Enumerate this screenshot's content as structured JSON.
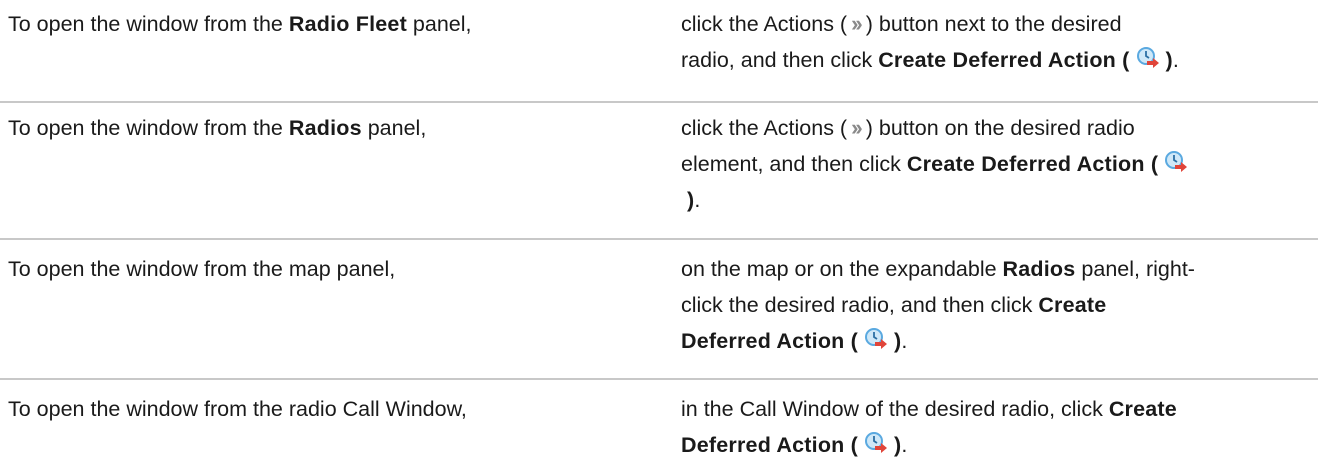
{
  "rows": [
    {
      "left": {
        "prefix": "To open the window from the ",
        "bold": "Radio Fleet",
        "suffix": " panel,"
      },
      "right": {
        "line_a": "click the Actions (",
        "line_b": ") button next to the desired",
        "line_c": "radio, and then click ",
        "bold": "Create Deferred Action (",
        "close": ")",
        "end": "."
      }
    },
    {
      "left": {
        "prefix": "To open the window from the ",
        "bold": "Radios",
        "suffix": " panel,"
      },
      "right": {
        "line_a": "click the Actions (",
        "line_b": ") button on the desired radio",
        "line_c": "element, and then click ",
        "bold": "Create Deferred Action (",
        "close": ")",
        "end": "."
      }
    },
    {
      "left": {
        "text": "To open the window from the map panel,"
      },
      "right": {
        "line_a": "on the map or on the expandable ",
        "bold_a": "Radios",
        "line_b": " panel, right-",
        "line_c": "click the desired radio, and then click ",
        "bold_b": "Create",
        "bold_c": "Deferred Action (",
        "close": ")",
        "end": "."
      }
    },
    {
      "left": {
        "text": "To open the window from the radio Call Window,"
      },
      "right": {
        "line_a": "in the Call Window of the desired radio, click ",
        "bold_a": "Create",
        "bold_b": "Deferred Action (",
        "close": ")",
        "end": "."
      }
    }
  ],
  "icons": {
    "actions": "double-chevron-right-icon",
    "deferred_action": "create-deferred-action-icon",
    "actions_color": "#8a8a8a",
    "clock_color": "#5aa9e0",
    "arrow_color": "#e0453a"
  }
}
